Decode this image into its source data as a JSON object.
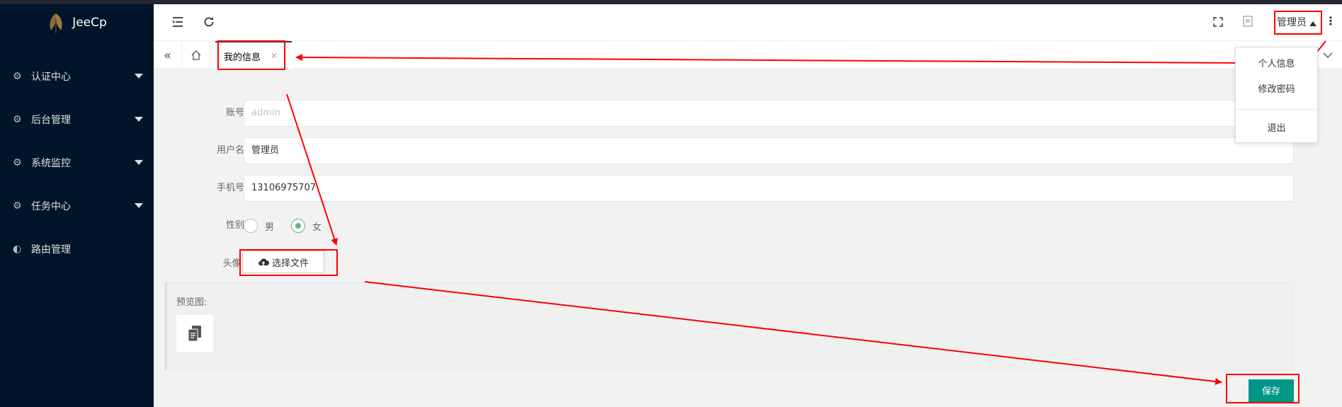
{
  "app": {
    "name": "JeeCp"
  },
  "sidebar": {
    "items": [
      {
        "label": "认证中心"
      },
      {
        "label": "后台管理"
      },
      {
        "label": "系统监控"
      },
      {
        "label": "任务中心"
      },
      {
        "label": "路由管理"
      }
    ]
  },
  "header": {
    "user": "管理员"
  },
  "tabs": {
    "active": "我的信息"
  },
  "dropdown": {
    "items": [
      "个人信息",
      "修改密码",
      "退出"
    ]
  },
  "form": {
    "account": {
      "label": "账号",
      "value": "admin"
    },
    "username": {
      "label": "用户名",
      "value": "管理员"
    },
    "phone": {
      "label": "手机号",
      "value": "13106975707"
    },
    "gender": {
      "label": "性别",
      "options": [
        "男",
        "女"
      ],
      "selected": "女"
    },
    "avatar": {
      "label": "头像:",
      "button": "选择文件"
    },
    "preview": {
      "label": "预览图:"
    },
    "save": "保存"
  },
  "colors": {
    "sidebar": "#001529",
    "accent": "#009688",
    "annotation": "#ff0000",
    "radio": "#5fb878"
  }
}
